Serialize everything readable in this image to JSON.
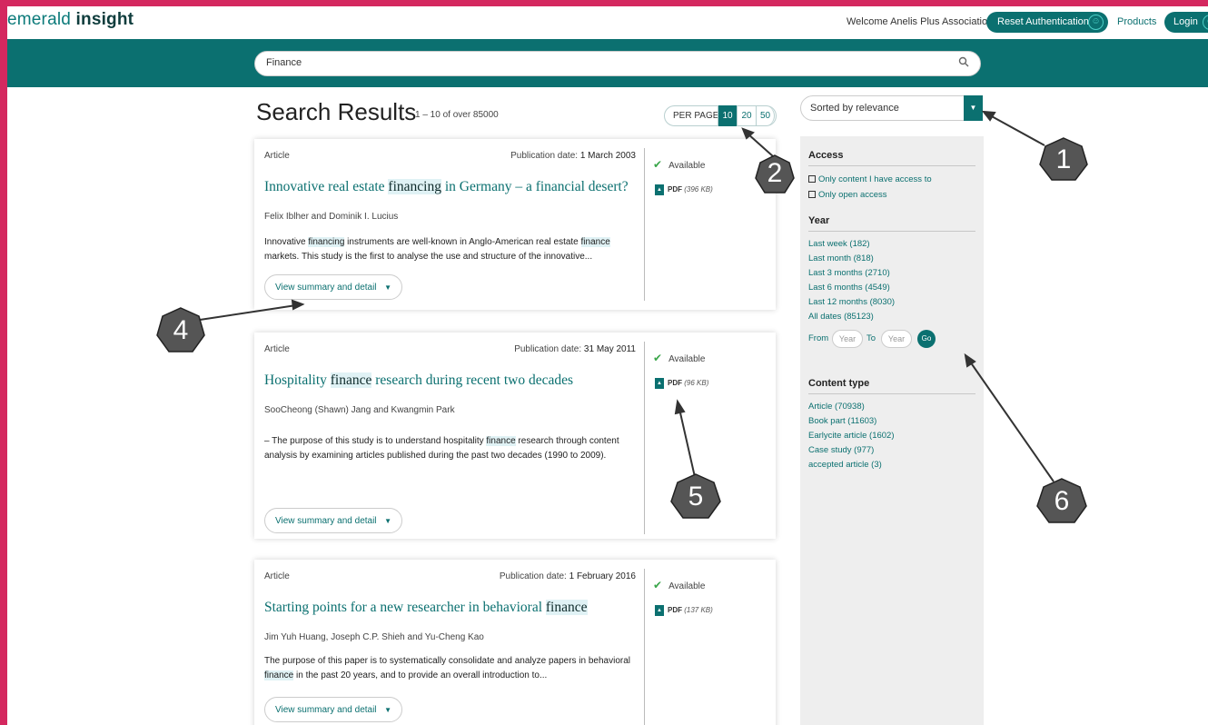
{
  "header": {
    "logo_light": "emerald",
    "logo_bold": "insight",
    "welcome": "Welcome Anelis Plus Association",
    "reset_auth": "Reset Authentication",
    "products": "Products",
    "login": "Login"
  },
  "search": {
    "value": "Finance"
  },
  "results": {
    "title": "Search Results",
    "count": "1 – 10 of over 85000",
    "per_page_label": "PER PAGE",
    "per_page_options": [
      "10",
      "20",
      "50"
    ],
    "sort": "Sorted by relevance",
    "items": [
      {
        "type": "Article",
        "pub_label": "Publication date:",
        "pub_date": "1 March 2003",
        "title_pre": "Innovative real estate ",
        "title_hl": "financing",
        "title_post": " in Germany – a financial desert?",
        "authors": "Felix Iblher and Dominik I. Lucius",
        "abstract_1": "Innovative ",
        "abstract_hl1": "financing",
        "abstract_2": " instruments are well-known in Anglo-American real estate ",
        "abstract_hl2": "finance",
        "abstract_3": " markets. This study is the first to analyse the use and structure of the innovative...",
        "availability": "Available",
        "pdf": "PDF",
        "pdf_size": "(396 KB)",
        "view": "View summary and detail"
      },
      {
        "type": "Article",
        "pub_label": "Publication date:",
        "pub_date": "31 May 2011",
        "title_pre": "Hospitality ",
        "title_hl": "finance",
        "title_post": " research during recent two decades",
        "authors": "SooCheong (Shawn) Jang and Kwangmin Park",
        "abstract_1": "– The purpose of this study is to understand hospitality ",
        "abstract_hl1": "finance",
        "abstract_2": " research through content analysis by examining articles published during the past two decades (1990 to 2009).",
        "availability": "Available",
        "pdf": "PDF",
        "pdf_size": "(96 KB)",
        "view": "View summary and detail"
      },
      {
        "type": "Article",
        "pub_label": "Publication date:",
        "pub_date": "1 February 2016",
        "title_pre": "Starting points for a new researcher in behavioral ",
        "title_hl": "finance",
        "title_post": "",
        "authors": "Jim Yuh Huang, Joseph C.P. Shieh and Yu-Cheng Kao",
        "abstract_1": "The purpose of this paper is to systematically consolidate and analyze papers in behavioral ",
        "abstract_hl1": "finance",
        "abstract_2": " in the past 20 years, and to provide an overall introduction to...",
        "availability": "Available",
        "pdf": "PDF",
        "pdf_size": "(137 KB)",
        "view": "View summary and detail"
      }
    ]
  },
  "sidebar": {
    "access_heading": "Access",
    "access_options": [
      "Only content I have access to",
      "Only open access"
    ],
    "year_heading": "Year",
    "year_options": [
      "Last week (182)",
      "Last month (818)",
      "Last 3 months (2710)",
      "Last 6 months (4549)",
      "Last 12 months (8030)",
      "All dates (85123)"
    ],
    "from_label": "From",
    "to_label": "To",
    "year_placeholder": "Year",
    "go": "Go",
    "content_heading": "Content type",
    "content_options": [
      "Article (70938)",
      "Book part (11603)",
      "Earlycite article (1602)",
      "Case study (977)",
      "accepted article (3)"
    ]
  },
  "callouts": [
    "1",
    "2",
    "4",
    "5",
    "6"
  ],
  "colors": {
    "brand": "#0b7070",
    "frame": "#d4285f",
    "callout": "#555555"
  }
}
